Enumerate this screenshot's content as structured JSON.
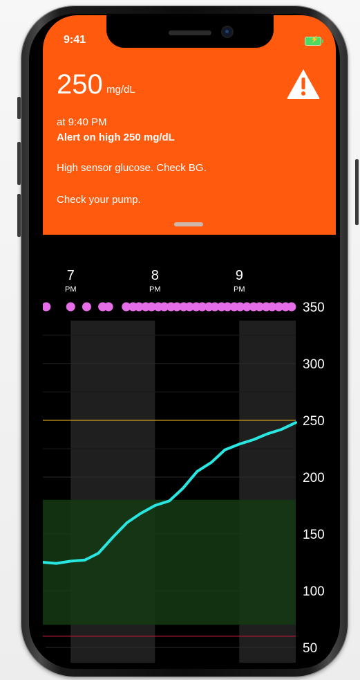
{
  "status_bar": {
    "time": "9:41",
    "battery_icon": "battery-charging-icon"
  },
  "alert": {
    "value": "250",
    "unit": "mg/dL",
    "time_line": "at 9:40 PM",
    "title": "Alert on high 250 mg/dL",
    "message_1": "High sensor glucose. Check BG.",
    "message_2": "Check your pump.",
    "icon": "warning-triangle-icon"
  },
  "colors": {
    "header": "#ff5a0d",
    "line": "#29e6e0",
    "dots": "#e56ee8",
    "high_line": "#c9a11a",
    "low_line": "#c3163d",
    "target_band": "#143a14"
  },
  "chart_data": {
    "type": "line",
    "x_ticks": [
      {
        "hour": "7",
        "suffix": "PM",
        "x": 19.0
      },
      {
        "hour": "8",
        "suffix": "PM",
        "x": 20.0
      },
      {
        "hour": "9",
        "suffix": "PM",
        "x": 21.0
      }
    ],
    "xlim": [
      18.67,
      21.67
    ],
    "y_ticks": [
      "350",
      "300",
      "250",
      "200",
      "150",
      "100",
      "50"
    ],
    "ylim": [
      50,
      350
    ],
    "high_threshold": 250,
    "low_threshold": 60,
    "target_range": [
      70,
      180
    ],
    "series": [
      {
        "x": [
          18.67,
          18.83,
          19.0,
          19.17,
          19.33,
          19.5,
          19.67,
          19.83,
          20.0,
          20.17,
          20.33,
          20.5,
          20.67,
          20.83,
          21.0,
          21.17,
          21.33,
          21.5,
          21.67
        ],
        "values": [
          125,
          124,
          126,
          127,
          133,
          147,
          160,
          168,
          175,
          179,
          190,
          205,
          213,
          224,
          229,
          233,
          238,
          242,
          248
        ]
      }
    ],
    "dots_y": 350,
    "dots_x": [
      18.71,
      19.0,
      19.19,
      19.38,
      19.45,
      19.66,
      19.74,
      19.81,
      19.89,
      19.96,
      20.04,
      20.11,
      20.19,
      20.26,
      20.34,
      20.41,
      20.49,
      20.56,
      20.64,
      20.71,
      20.79,
      20.86,
      20.94,
      21.01,
      21.09,
      21.17,
      21.24,
      21.32,
      21.39,
      21.47,
      21.55,
      21.62
    ]
  }
}
